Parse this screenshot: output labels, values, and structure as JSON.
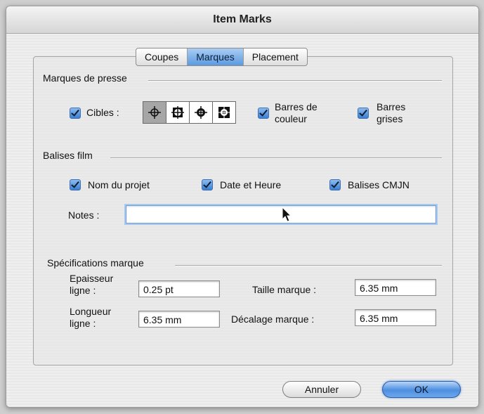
{
  "window": {
    "title": "Item Marks"
  },
  "tabs": [
    {
      "label": "Coupes",
      "active": false
    },
    {
      "label": "Marques",
      "active": true
    },
    {
      "label": "Placement",
      "active": false
    }
  ],
  "press_marks": {
    "title": "Marques de presse",
    "targets_label": "Cibles :",
    "targets_checked": true,
    "target_icons": [
      "crosshair-target-icon",
      "box-target-icon",
      "gear-target-icon",
      "square-gear-target-icon"
    ],
    "selected_target_index": 0,
    "color_bars": {
      "label_line1": "Barres de",
      "label_line2": "couleur",
      "checked": true
    },
    "gray_bars": {
      "label_line1": "Barres",
      "label_line2": "grises",
      "checked": true
    }
  },
  "film_marks": {
    "title": "Balises film",
    "project_name": {
      "label": "Nom du projet",
      "checked": true
    },
    "date_time": {
      "label": "Date et Heure",
      "checked": true
    },
    "cmyk_marks": {
      "label": "Balises CMJN",
      "checked": true
    },
    "notes_label": "Notes :",
    "notes_value": ""
  },
  "mark_specs": {
    "title": "Spécifications marque",
    "line_weight": {
      "label_line1": "Epaisseur",
      "label_line2": "ligne :",
      "value": "0.25 pt"
    },
    "mark_size": {
      "label": "Taille marque :",
      "value": "6.35 mm"
    },
    "line_length": {
      "label_line1": "Longueur",
      "label_line2": "ligne :",
      "value": "6.35 mm"
    },
    "mark_offset": {
      "label": "Décalage marque :",
      "value": "6.35 mm"
    }
  },
  "buttons": {
    "cancel": "Annuler",
    "ok": "OK"
  },
  "colors": {
    "accent": "#5b9ae0",
    "checkbox": "#3a7fd3"
  }
}
